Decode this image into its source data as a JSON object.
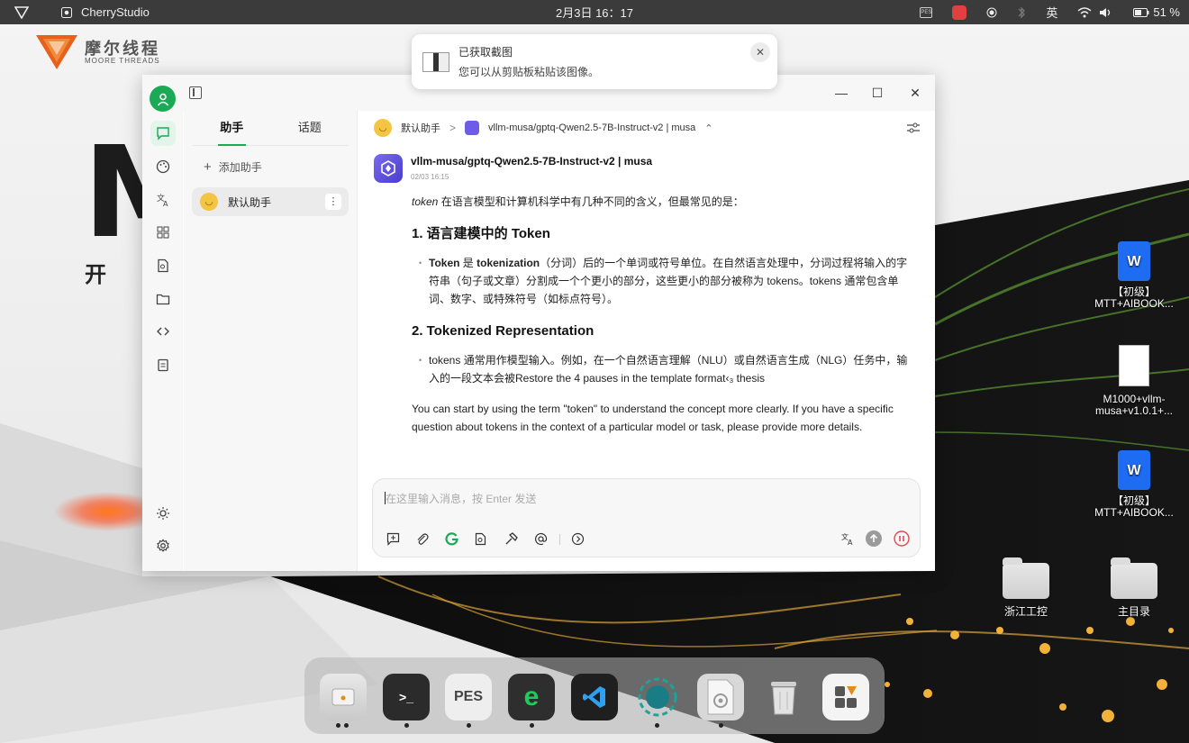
{
  "topbar": {
    "app_name": "CherryStudio",
    "clock": "2月3日  16：17",
    "ime": "英",
    "battery": "51 %",
    "pes_label": "PES"
  },
  "brand": {
    "cn": "摩尔线程",
    "en": "MOORE THREADS",
    "big_letter": "M",
    "big_char": "开"
  },
  "notification": {
    "title": "已获取截图",
    "message": "您可以从剪贴板粘贴该图像。",
    "close_glyph": "✕"
  },
  "window": {
    "min_glyph": "—",
    "max_glyph": "☐",
    "close_glyph": "✕"
  },
  "sidebar": {
    "tabs": [
      "助手",
      "话题"
    ],
    "add_label": "添加助手",
    "add_glyph": "+",
    "assistants": [
      {
        "name": "默认助手",
        "more": "⋮"
      }
    ]
  },
  "chat": {
    "breadcrumb_assistant": "默认助手",
    "breadcrumb_sep": ">",
    "model": "vllm-musa/gptq-Qwen2.5-7B-Instruct-v2 | musa",
    "model_switch_glyph": "⌃",
    "message": {
      "model": "vllm-musa/gptq-Qwen2.5-7B-Instruct-v2 | musa",
      "time": "02/03 16:15",
      "intro_em": "token",
      "intro": " 在语言模型和计算机科学中有几种不同的含义，但最常见的是：",
      "h1": "1. 语言建模中的 Token",
      "b1_strong1": "Token",
      "b1_mid": " 是 ",
      "b1_strong2": "tokenization",
      "b1_rest": "（分词）后的一个单词或符号单位。在自然语言处理中，分词过程将输入的字符串（句子或文章）分割成一个个更小的部分，这些更小的部分被称为 tokens。tokens 通常包含单词、数字、或特殊符号（如标点符号）。",
      "h2": "2. Tokenized Representation",
      "b2": "tokens 通常用作模型输入。例如，在一个自然语言理解（NLU）或自然语言生成（NLG）任务中，输入的一段文本会被Restore the 4 pauses in the template format‹₃ thesis",
      "outro": "You can start by using the term \"token\" to understand the concept more clearly. If you have a specific question about tokens in the context of a particular model or task, please provide more details."
    },
    "input_placeholder": "在这里输入消息，按 Enter 发送"
  },
  "desktop": {
    "icons": [
      {
        "label": "【初级】 MTT+AIBOOK..."
      },
      {
        "label": "M1000+vllm-musa+v1.0.1+..."
      },
      {
        "label": "【初级】 MTT+AIBOOK..."
      },
      {
        "label": "浙江工控"
      },
      {
        "label": "主目录"
      }
    ],
    "wps_glyph": "W"
  },
  "dock": {
    "terminal_label": ">_",
    "pes_label": "PES",
    "edge_label": "e"
  },
  "colors": {
    "accent": "#1aaa55",
    "model_badge": "#6c5ce7",
    "stop_button": "#e5484d",
    "topbar": "#3b3b3b"
  }
}
